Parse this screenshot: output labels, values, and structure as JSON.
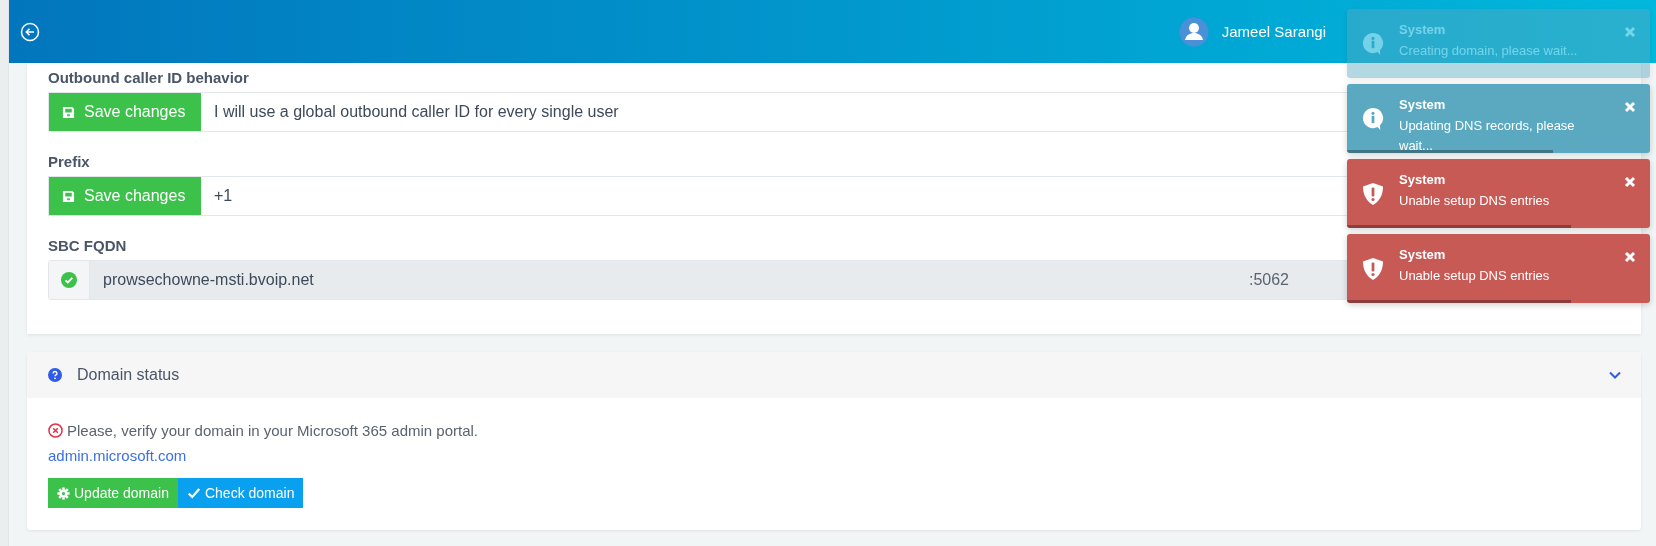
{
  "header": {
    "user_name": "Jameel Sarangi"
  },
  "settings": [
    {
      "label": "Outbound caller ID behavior",
      "kind": "save",
      "button": "Save changes",
      "value": "I will use a global outbound caller ID for every single user"
    },
    {
      "label": "Prefix",
      "kind": "save",
      "button": "Save changes",
      "value": "+1"
    },
    {
      "label": "SBC FQDN",
      "kind": "verified",
      "value": "prowsechowne-msti.bvoip.net",
      "suffix": ":5062"
    }
  ],
  "domain_status": {
    "title": "Domain status",
    "expanded": true,
    "message": "Please, verify your domain in your Microsoft 365 admin portal.",
    "link": "admin.microsoft.com",
    "buttons": [
      {
        "label": "Update domain",
        "kind": "update"
      },
      {
        "label": "Check domain",
        "kind": "check"
      }
    ]
  },
  "toasts": [
    {
      "kind": "info",
      "faded": true,
      "title": "System",
      "message": "Creating domain, please wait..."
    },
    {
      "kind": "info",
      "faded": false,
      "title": "System",
      "message": "Updating DNS records, please wait...",
      "level": 0.68
    },
    {
      "kind": "error",
      "faded": false,
      "title": "System",
      "message": "Unable setup DNS entries",
      "level": 0.74
    },
    {
      "kind": "error",
      "faded": false,
      "title": "System",
      "message": "Unable setup DNS entries",
      "level": 0.74
    }
  ]
}
